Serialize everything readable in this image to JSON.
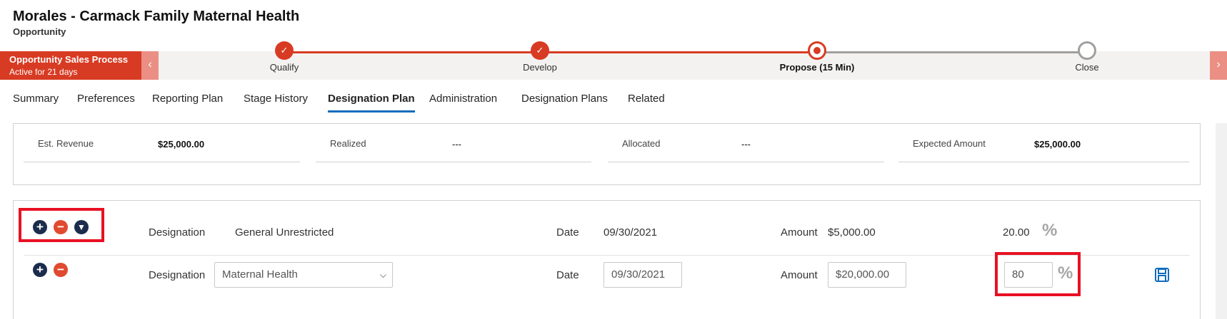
{
  "header": {
    "title": "Morales - Carmack Family Maternal Health",
    "subtitle": "Opportunity"
  },
  "process": {
    "name": "Opportunity Sales Process",
    "duration": "Active for 21 days",
    "stages": [
      {
        "label": "Qualify",
        "status": "completed"
      },
      {
        "label": "Develop",
        "status": "completed"
      },
      {
        "label": "Propose  (15 Min)",
        "status": "active"
      },
      {
        "label": "Close",
        "status": "pending"
      }
    ],
    "nav_left_icon": "chevron-left-icon",
    "nav_right_icon": "chevron-right-icon"
  },
  "tabs": [
    {
      "label": "Summary"
    },
    {
      "label": "Preferences"
    },
    {
      "label": "Reporting Plan"
    },
    {
      "label": "Stage History"
    },
    {
      "label": "Designation Plan",
      "active": true
    },
    {
      "label": "Administration"
    },
    {
      "label": "Designation Plans"
    },
    {
      "label": "Related"
    }
  ],
  "summary": {
    "est_revenue_label": "Est. Revenue",
    "est_revenue_value": "$25,000.00",
    "realized_label": "Realized",
    "realized_value": "---",
    "allocated_label": "Allocated",
    "allocated_value": "---",
    "expected_label": "Expected Amount",
    "expected_value": "$25,000.00"
  },
  "plan": {
    "rows": [
      {
        "designation_label": "Designation",
        "designation_value": "General Unrestricted",
        "date_label": "Date",
        "date_value": "09/30/2021",
        "amount_label": "Amount",
        "amount_value": "$5,000.00",
        "percent_value": "20.00",
        "percent_symbol": "%"
      },
      {
        "designation_label": "Designation",
        "designation_value": "Maternal Health",
        "date_label": "Date",
        "date_value": "09/30/2021",
        "amount_label": "Amount",
        "amount_value": "$20,000.00",
        "percent_value": "80",
        "percent_symbol": "%"
      }
    ]
  },
  "colors": {
    "accent": "#d83b23",
    "tab_underline": "#0f6cbd",
    "highlight": "#e81123",
    "icon_navy": "#1b2c4c"
  }
}
